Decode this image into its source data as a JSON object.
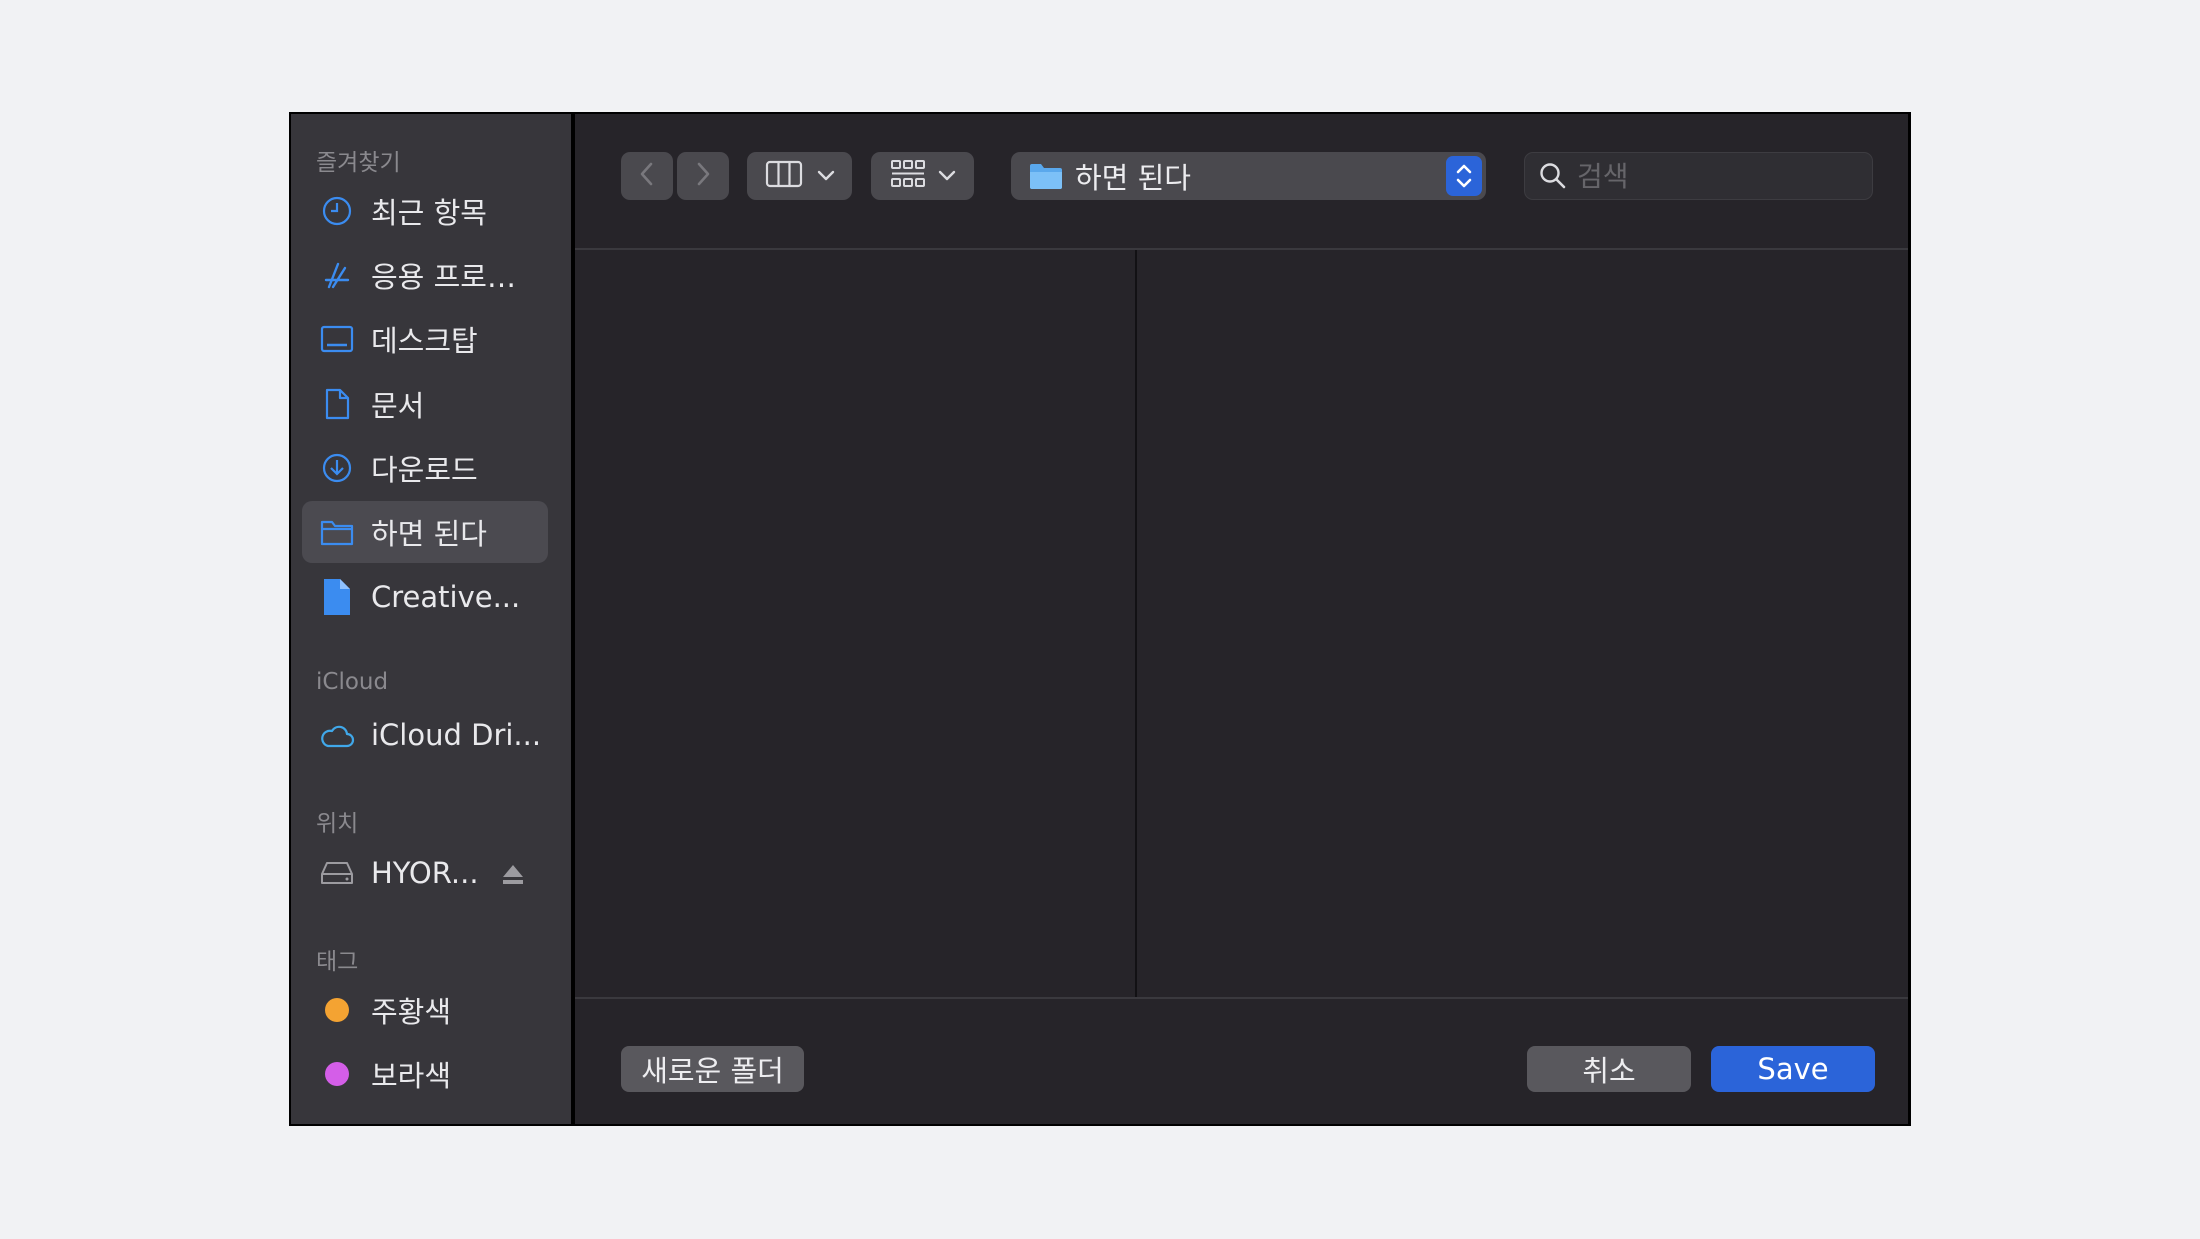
{
  "sidebar": {
    "favorites_title": "즐겨찾기",
    "favorites": [
      {
        "label": "최근 항목",
        "icon": "clock-icon"
      },
      {
        "label": "응용 프로…",
        "icon": "applications-icon"
      },
      {
        "label": "데스크탑",
        "icon": "desktop-icon"
      },
      {
        "label": "문서",
        "icon": "document-icon"
      },
      {
        "label": "다운로드",
        "icon": "download-icon"
      },
      {
        "label": "하면 된다",
        "icon": "folder-icon",
        "selected": true
      },
      {
        "label": "Creative...",
        "icon": "file-icon"
      }
    ],
    "icloud_title": "iCloud",
    "icloud": [
      {
        "label": "iCloud Dri...",
        "icon": "cloud-icon"
      }
    ],
    "locations_title": "위치",
    "locations": [
      {
        "label": "HYOR...",
        "icon": "drive-icon",
        "eject_icon": "eject-icon"
      }
    ],
    "tags_title": "태그",
    "tags": [
      {
        "label": "주황색",
        "color": "#f4a332"
      },
      {
        "label": "보라색",
        "color": "#d45ee8"
      }
    ]
  },
  "toolbar": {
    "back_icon": "chevron-left-icon",
    "forward_icon": "chevron-right-icon",
    "columns_view_icon": "columns-view-icon",
    "group_icon": "grid-group-icon",
    "location_label": "하면 된다",
    "location_icon": "folder-icon",
    "search_placeholder": "검색",
    "search_icon": "search-icon"
  },
  "footer": {
    "new_folder_label": "새로운 폴더",
    "cancel_label": "취소",
    "save_label": "Save"
  },
  "colors": {
    "accent": "#2b64d9",
    "sidebar_icon": "#3b8cf0",
    "sidebar_bg": "#37363b",
    "main_bg": "#262429"
  }
}
